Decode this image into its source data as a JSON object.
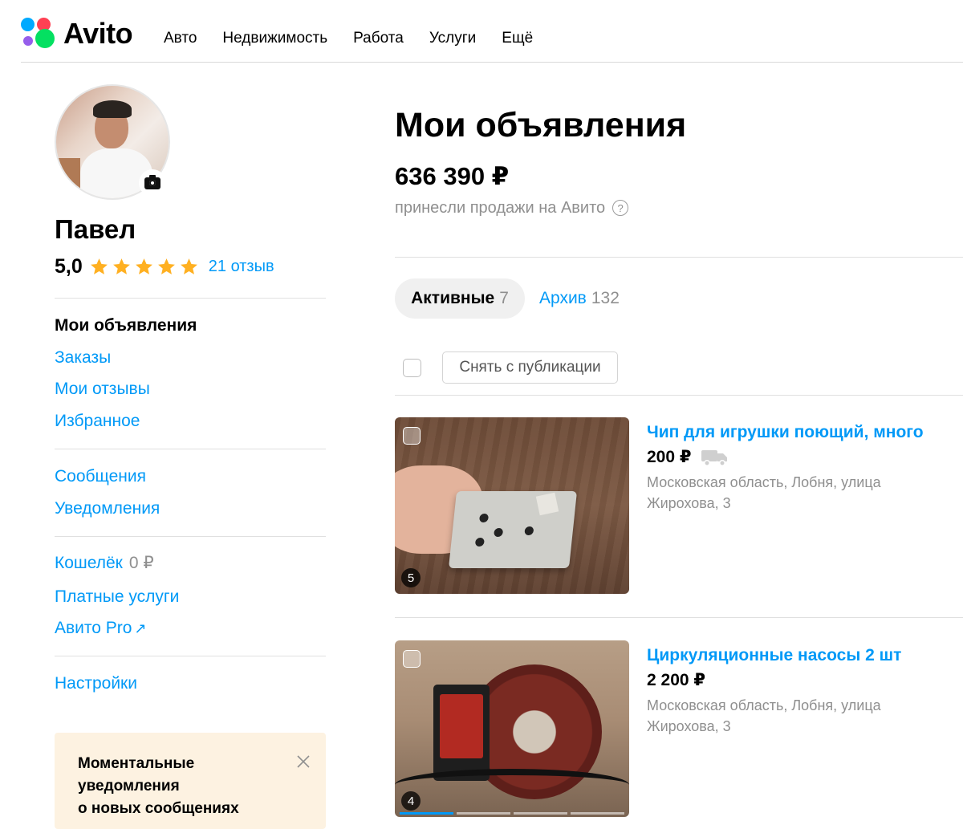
{
  "header": {
    "logo_text": "Avito",
    "nav": [
      "Авто",
      "Недвижимость",
      "Работа",
      "Услуги",
      "Ещё"
    ]
  },
  "profile": {
    "name": "Павел",
    "rating": "5,0",
    "stars": 5,
    "reviews_label": "21 отзыв"
  },
  "sidebar": {
    "groups": [
      [
        {
          "label": "Мои объявления",
          "active": true
        },
        {
          "label": "Заказы"
        },
        {
          "label": "Мои отзывы"
        },
        {
          "label": "Избранное"
        }
      ],
      [
        {
          "label": "Сообщения"
        },
        {
          "label": "Уведомления"
        }
      ],
      [
        {
          "label": "Кошелёк",
          "value": "0 ₽"
        },
        {
          "label": "Платные услуги"
        },
        {
          "label": "Авито Pro",
          "external": true
        }
      ],
      [
        {
          "label": "Настройки"
        }
      ]
    ],
    "wallet_label": "Кошелёк",
    "wallet_value": "0 ₽",
    "external_icon": "↗"
  },
  "promo": {
    "text": "Моментальные\nуведомления\nо новых сообщениях"
  },
  "main": {
    "title": "Мои объявления",
    "earned_amount": "636 390 ₽",
    "earned_caption": "принесли продажи на Авито",
    "help_icon": "?",
    "tabs": [
      {
        "label": "Активные",
        "count": "7",
        "active": true
      },
      {
        "label": "Архив",
        "count": "132"
      }
    ],
    "unpublish_label": "Снять с публикации"
  },
  "listings": [
    {
      "title": "Чип для игрушки поющий, много",
      "price": "200 ₽",
      "delivery": true,
      "address": "Московская область, Лобня, улица Жирохова, 3",
      "photo_count": "5"
    },
    {
      "title": "Циркуляционные насосы 2 шт",
      "price": "2 200 ₽",
      "delivery": false,
      "address": "Московская область, Лобня, улица Жирохова, 3",
      "photo_count": "4"
    }
  ],
  "colors": {
    "link": "#0099f7",
    "muted": "#8f8f8f",
    "star": "#ffb021",
    "promo_bg": "#fdf2e1",
    "tab_bg": "#f0f0f0"
  }
}
